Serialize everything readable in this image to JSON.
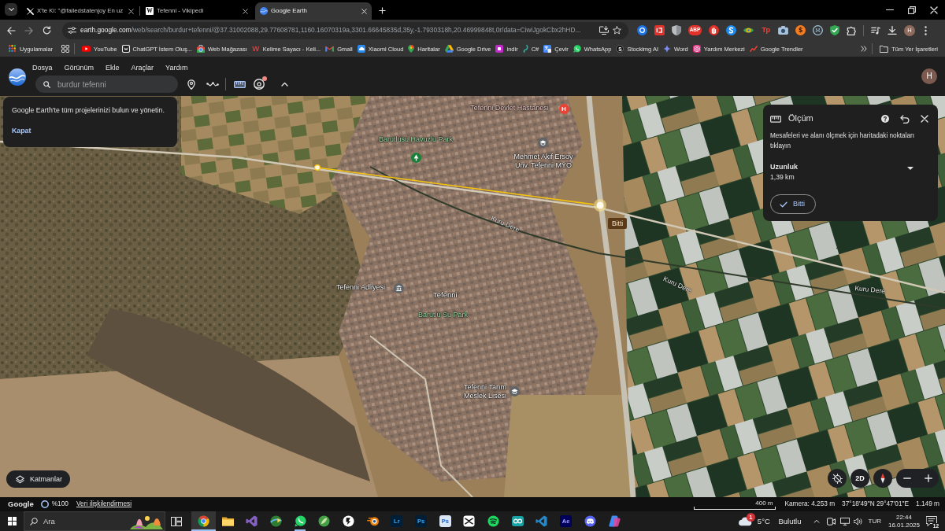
{
  "browser": {
    "tabs": [
      {
        "kind": "crossmark",
        "title": "X'te Ki: \"@failedstatenjoy En uz",
        "selected": false
      },
      {
        "kind": "letter",
        "icon_label": "W",
        "title": "Tefenni - Vikipedi",
        "selected": false
      },
      {
        "kind": "globe",
        "title": "Google Earth",
        "selected": true
      }
    ],
    "url_host": "earth.google.com",
    "url_path": "/web/search/burdur+tefenni/@37.31002088,29.77608781,1160.16070319a,3301.66645835d,35y,-1.7930318h,20.46999848t,0r/data=CiwiJgokCbx2hHD...",
    "extensions": [
      {
        "kind": "disc"
      },
      {
        "kind": "square"
      },
      {
        "kind": "shield"
      },
      {
        "kind": "stopsign",
        "label": "ABP"
      },
      {
        "kind": "hand"
      },
      {
        "kind": "swirl"
      },
      {
        "kind": "eye"
      },
      {
        "kind": "wordmark",
        "label": "Tp"
      },
      {
        "kind": "camera"
      },
      {
        "kind": "coin",
        "label": "$"
      },
      {
        "kind": "face"
      },
      {
        "kind": "checkshield"
      },
      {
        "kind": "puzzle"
      }
    ],
    "profile_initial": "H",
    "apps_shortcut": "Uygulamalar",
    "bookmarks": [
      {
        "kind": "video",
        "label": "YouTube"
      },
      {
        "kind": "dark",
        "label": "ChatGPT İstem Oluş..."
      },
      {
        "kind": "store",
        "label": "Web Mağazası"
      },
      {
        "kind": "letter",
        "icon_label": "W",
        "label": "Kelime Sayacı - Keli..."
      },
      {
        "kind": "mail",
        "label": "Gmail"
      },
      {
        "kind": "cloud",
        "label": "Xiaomi Cloud"
      },
      {
        "kind": "pin",
        "label": "Haritalar"
      },
      {
        "kind": "drive",
        "label": "Google Drive"
      },
      {
        "kind": "tile",
        "label": "indir"
      },
      {
        "kind": "hook",
        "label": "C#"
      },
      {
        "kind": "translate",
        "label": "Çevir"
      },
      {
        "kind": "chat",
        "label": "WhatsApp"
      },
      {
        "kind": "coin",
        "icon_label": "S",
        "label": "Stockimg AI"
      },
      {
        "kind": "spark",
        "label": "Word"
      },
      {
        "kind": "camera",
        "label": "Yardım Merkezi"
      },
      {
        "kind": "trend",
        "label": "Google Trendler"
      }
    ],
    "all_bookmarks": "Tüm Yer İşaretleri"
  },
  "earth": {
    "menu": [
      "Dosya",
      "Görünüm",
      "Ekle",
      "Araçlar",
      "Yardım"
    ],
    "search_placeholder": "burdur tefenni",
    "tools": [
      {
        "kind": "placemark",
        "active": false,
        "dot": false
      },
      {
        "kind": "path",
        "active": false,
        "dot": false
      },
      {
        "kind": "measure",
        "active": true,
        "dot": false
      },
      {
        "kind": "tour",
        "active": false,
        "dot": true
      }
    ],
    "account_initial": "H",
    "tip": {
      "message": "Google Earth'te tüm projelerinizi bulun ve yönetin.",
      "action": "Kapat"
    },
    "map": {
      "places": [
        {
          "kind": "hospital",
          "name": "Tefenni Devlet Hastanesi",
          "icon_label": "H"
        },
        {
          "kind": "park",
          "name": "Barutlusu Havuzlu Park"
        },
        {
          "kind": "school",
          "name": "Mehmet Akif Ersoy Unv. Tefenni MYO"
        },
        {
          "kind": "civic",
          "name": "Tefenni Adliyesi"
        },
        {
          "kind": "town",
          "name": "Tefenni"
        },
        {
          "kind": "park",
          "name": "Barutlu Su Park"
        },
        {
          "kind": "school",
          "name": "Tefenni Tarım Meslek Lisesi"
        }
      ],
      "streams": [
        "Kuru Dere",
        "Kuru Dere",
        "Kuru Dere"
      ],
      "measure_tag": "Bitti"
    },
    "measure_panel": {
      "title": "Ölçüm",
      "hint": "Mesafeleri ve alanı ölçmek için haritadaki noktaları tıklayın",
      "metric": "Uzunluk",
      "value": "1,39 km",
      "done": "Bitti"
    },
    "layers": "Katmanlar",
    "view_mode": "2D",
    "status": {
      "brand": "Google",
      "load": "%100",
      "attribution": "Veri ilişkilendirmesi",
      "scale": "400 m",
      "camera": "Kamera: 4.253 m",
      "coordinates": "37°18'49\"N 29°47'01\"E",
      "elevation": "1.149 m"
    }
  },
  "taskbar": {
    "search_placeholder": "Ara",
    "apps": [
      {
        "kind": "browser",
        "selected": true,
        "running": true
      },
      {
        "kind": "folder",
        "selected": false,
        "running": false
      },
      {
        "kind": "ribbon",
        "selected": false,
        "running": false
      },
      {
        "kind": "globe",
        "selected": false,
        "running": false
      },
      {
        "kind": "chat",
        "selected": false,
        "running": true
      },
      {
        "kind": "leaf",
        "selected": false,
        "running": false
      },
      {
        "kind": "bolt",
        "selected": false,
        "running": false
      },
      {
        "kind": "orbit",
        "selected": false,
        "running": false
      },
      {
        "kind": "tile",
        "label": "Lr",
        "color": "#001e36",
        "selected": false,
        "running": false
      },
      {
        "kind": "tile",
        "label": "Ps",
        "color": "#001e36",
        "selected": false,
        "running": false
      },
      {
        "kind": "tile",
        "label": "Ps",
        "color": "#dbe6f4",
        "selected": false,
        "running": false
      },
      {
        "kind": "clip",
        "selected": false,
        "running": false
      },
      {
        "kind": "waves",
        "selected": false,
        "running": false
      },
      {
        "kind": "loop",
        "selected": false,
        "running": false
      },
      {
        "kind": "code",
        "selected": false,
        "running": false
      },
      {
        "kind": "tile",
        "label": "Ae",
        "color": "#00005b",
        "selected": false,
        "running": false
      },
      {
        "kind": "gamepad",
        "selected": false,
        "running": false
      },
      {
        "kind": "prism",
        "selected": false,
        "running": false
      }
    ],
    "weather": {
      "badge": "1",
      "temperature": "5°C",
      "condition": "Bulutlu"
    },
    "language": "TUR",
    "time": "22:44",
    "date": "16.01.2025",
    "notification_count": "12"
  }
}
